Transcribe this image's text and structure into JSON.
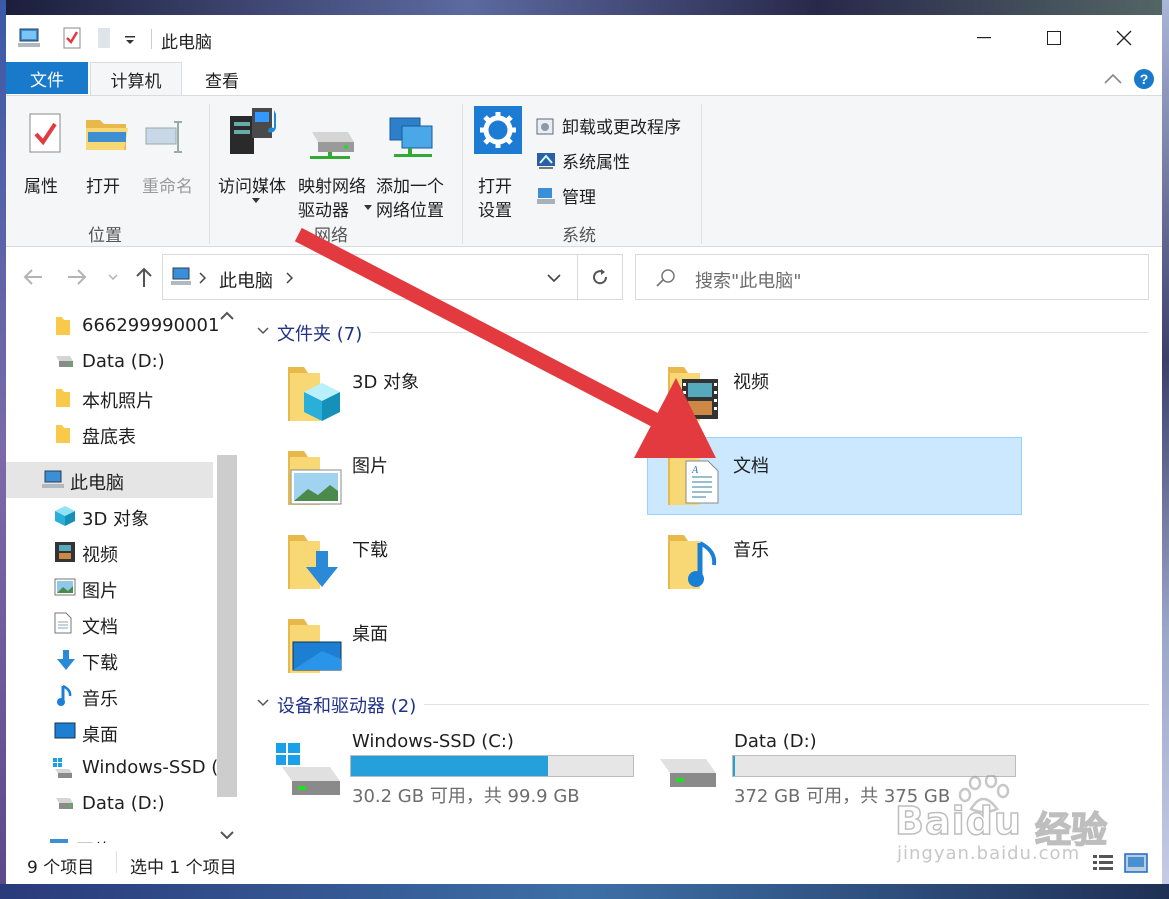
{
  "window": {
    "title": "此电脑"
  },
  "ribbon": {
    "tabs": [
      {
        "label": "文件"
      },
      {
        "label": "计算机"
      },
      {
        "label": "查看"
      }
    ],
    "buttons": {
      "properties": "属性",
      "open": "打开",
      "rename": "重命名",
      "media": "访问媒体",
      "map_drive_1": "映射网络",
      "map_drive_2": "驱动器",
      "add_location_1": "添加一个",
      "add_location_2": "网络位置",
      "open_settings_1": "打开",
      "open_settings_2": "设置",
      "uninstall": "卸载或更改程序",
      "system_props": "系统属性",
      "manage": "管理"
    },
    "groups": {
      "location": "位置",
      "network": "网络",
      "system": "系统"
    }
  },
  "address": {
    "crumb": "此电脑",
    "search_placeholder": "搜索\"此电脑\""
  },
  "nav": {
    "items": [
      {
        "label": "666299990001",
        "icon": "folder-icon"
      },
      {
        "label": "Data (D:)",
        "icon": "drive-icon"
      },
      {
        "label": "本机照片",
        "icon": "folder-icon"
      },
      {
        "label": "盘底表",
        "icon": "folder-icon"
      },
      {
        "label": "此电脑",
        "icon": "computer-icon"
      },
      {
        "label": "3D 对象",
        "icon": "cube-icon"
      },
      {
        "label": "视频",
        "icon": "video-icon"
      },
      {
        "label": "图片",
        "icon": "picture-icon"
      },
      {
        "label": "文档",
        "icon": "document-icon"
      },
      {
        "label": "下载",
        "icon": "download-icon"
      },
      {
        "label": "音乐",
        "icon": "music-icon"
      },
      {
        "label": "桌面",
        "icon": "desktop-icon"
      },
      {
        "label": "Windows-SSD (",
        "icon": "windows-drive-icon"
      },
      {
        "label": "Data (D:)",
        "icon": "drive-icon"
      },
      {
        "label": "网络",
        "icon": "network-icon"
      }
    ]
  },
  "content": {
    "folders_header": "文件夹 (7)",
    "folders": [
      {
        "label": "3D 对象"
      },
      {
        "label": "视频"
      },
      {
        "label": "图片"
      },
      {
        "label": "文档"
      },
      {
        "label": "下载"
      },
      {
        "label": "音乐"
      },
      {
        "label": "桌面"
      }
    ],
    "drives_header": "设备和驱动器 (2)",
    "drives": [
      {
        "label": "Windows-SSD (C:)",
        "space": "30.2 GB 可用，共 99.9 GB",
        "used_fraction": 0.698
      },
      {
        "label": "Data (D:)",
        "space": "372 GB 可用，共 375 GB",
        "used_fraction": 0.008
      }
    ]
  },
  "status": {
    "count": "9 个项目",
    "selected": "选中 1 个项目"
  },
  "watermark": {
    "brand": "Baidu",
    "brand_cn": "经验",
    "url": "jingyan.baidu.com"
  },
  "colors": {
    "accent": "#1979ca",
    "selection": "#cce8ff",
    "arrow": "#e23a3f",
    "folder": "#f8d775"
  }
}
